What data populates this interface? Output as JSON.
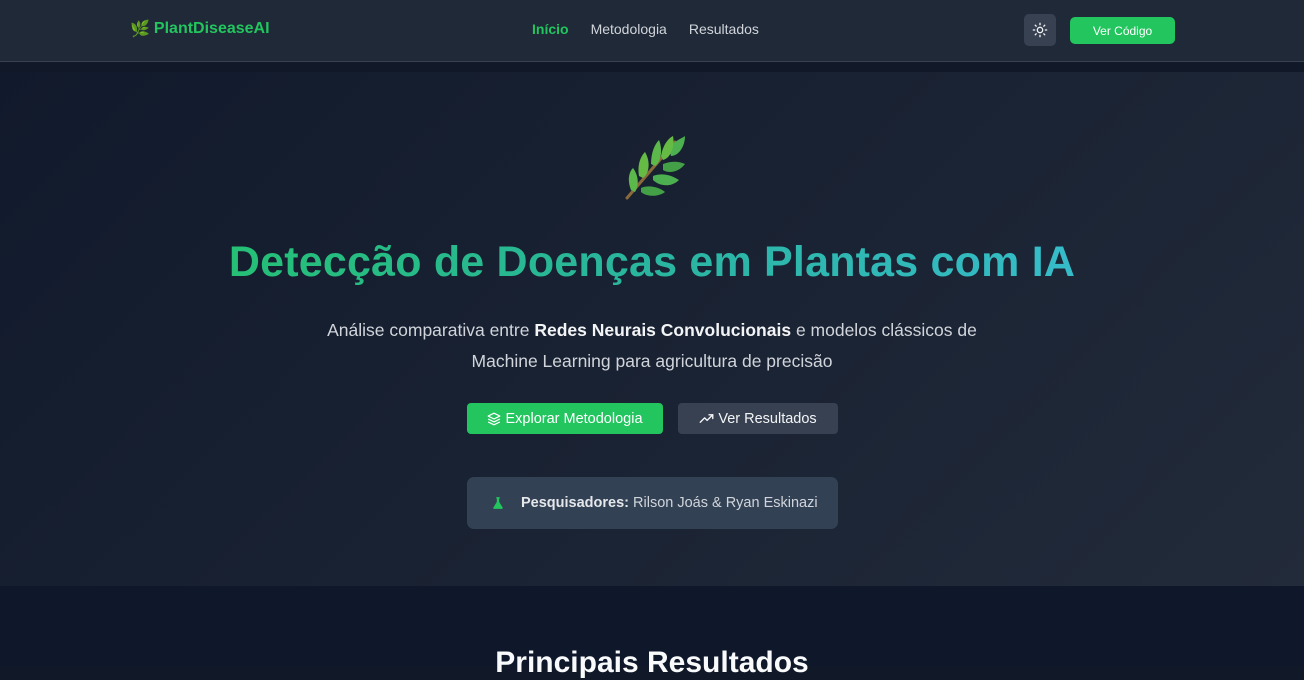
{
  "brand": {
    "icon": "leaf-icon",
    "name": "PlantDiseaseAI"
  },
  "nav": {
    "items": [
      {
        "label": "Início",
        "active": true
      },
      {
        "label": "Metodologia",
        "active": false
      },
      {
        "label": "Resultados",
        "active": false
      }
    ],
    "theme_toggle_icon": "sun-icon",
    "code_button_label": "Ver Código"
  },
  "hero": {
    "icon": "leaf-icon",
    "title": "Detecção de Doenças em Plantas com IA",
    "subtitle_pre": "Análise comparativa entre ",
    "subtitle_bold": "Redes Neurais Convolucionais",
    "subtitle_post": " e modelos clássicos de Machine Learning para agricultura de precisão",
    "primary_button": {
      "label": "Explorar Metodologia",
      "icon": "layers-icon"
    },
    "secondary_button": {
      "label": "Ver Resultados",
      "icon": "trending-up-icon"
    },
    "researchers": {
      "icon": "flask-icon",
      "label": "Pesquisadores:",
      "names": "Rilson Joás & Ryan Eskinazi"
    }
  },
  "results_section": {
    "title": "Principais Resultados"
  },
  "colors": {
    "accent": "#22c55e",
    "title_gradient_end": "#3cc0e0",
    "navbar_bg": "#1f2937",
    "page_bg": "#111827"
  }
}
